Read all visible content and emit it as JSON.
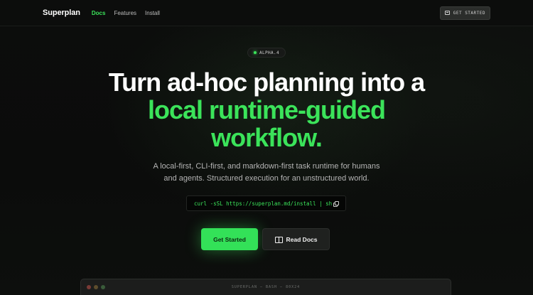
{
  "nav": {
    "brand": "Superplan",
    "links": [
      {
        "label": "Docs",
        "active": true
      },
      {
        "label": "Features",
        "active": false
      },
      {
        "label": "Install",
        "active": false
      }
    ],
    "cta_label": "GET STARTED",
    "cta_icon": "terminal-icon"
  },
  "badge": {
    "label": "ALPHA.4"
  },
  "hero": {
    "title_line1": "Turn ad-hoc planning into a",
    "title_line2": "local runtime-guided",
    "title_line3": "workflow.",
    "subtitle_line1": "A local-first, CLI-first, and markdown-first task runtime for humans",
    "subtitle_line2": "and agents. Structured execution for an unstructured world."
  },
  "install": {
    "command": "curl -sSL https://superplan.md/install | sh",
    "copy_icon": "copy-icon"
  },
  "buttons": {
    "primary": "Get Started",
    "secondary": "Read Docs",
    "secondary_icon": "book-icon"
  },
  "terminal": {
    "title": "SUPERPLAN — BASH — 80X24"
  },
  "colors": {
    "accent": "#3be35a",
    "background": "#0b0c0b"
  }
}
